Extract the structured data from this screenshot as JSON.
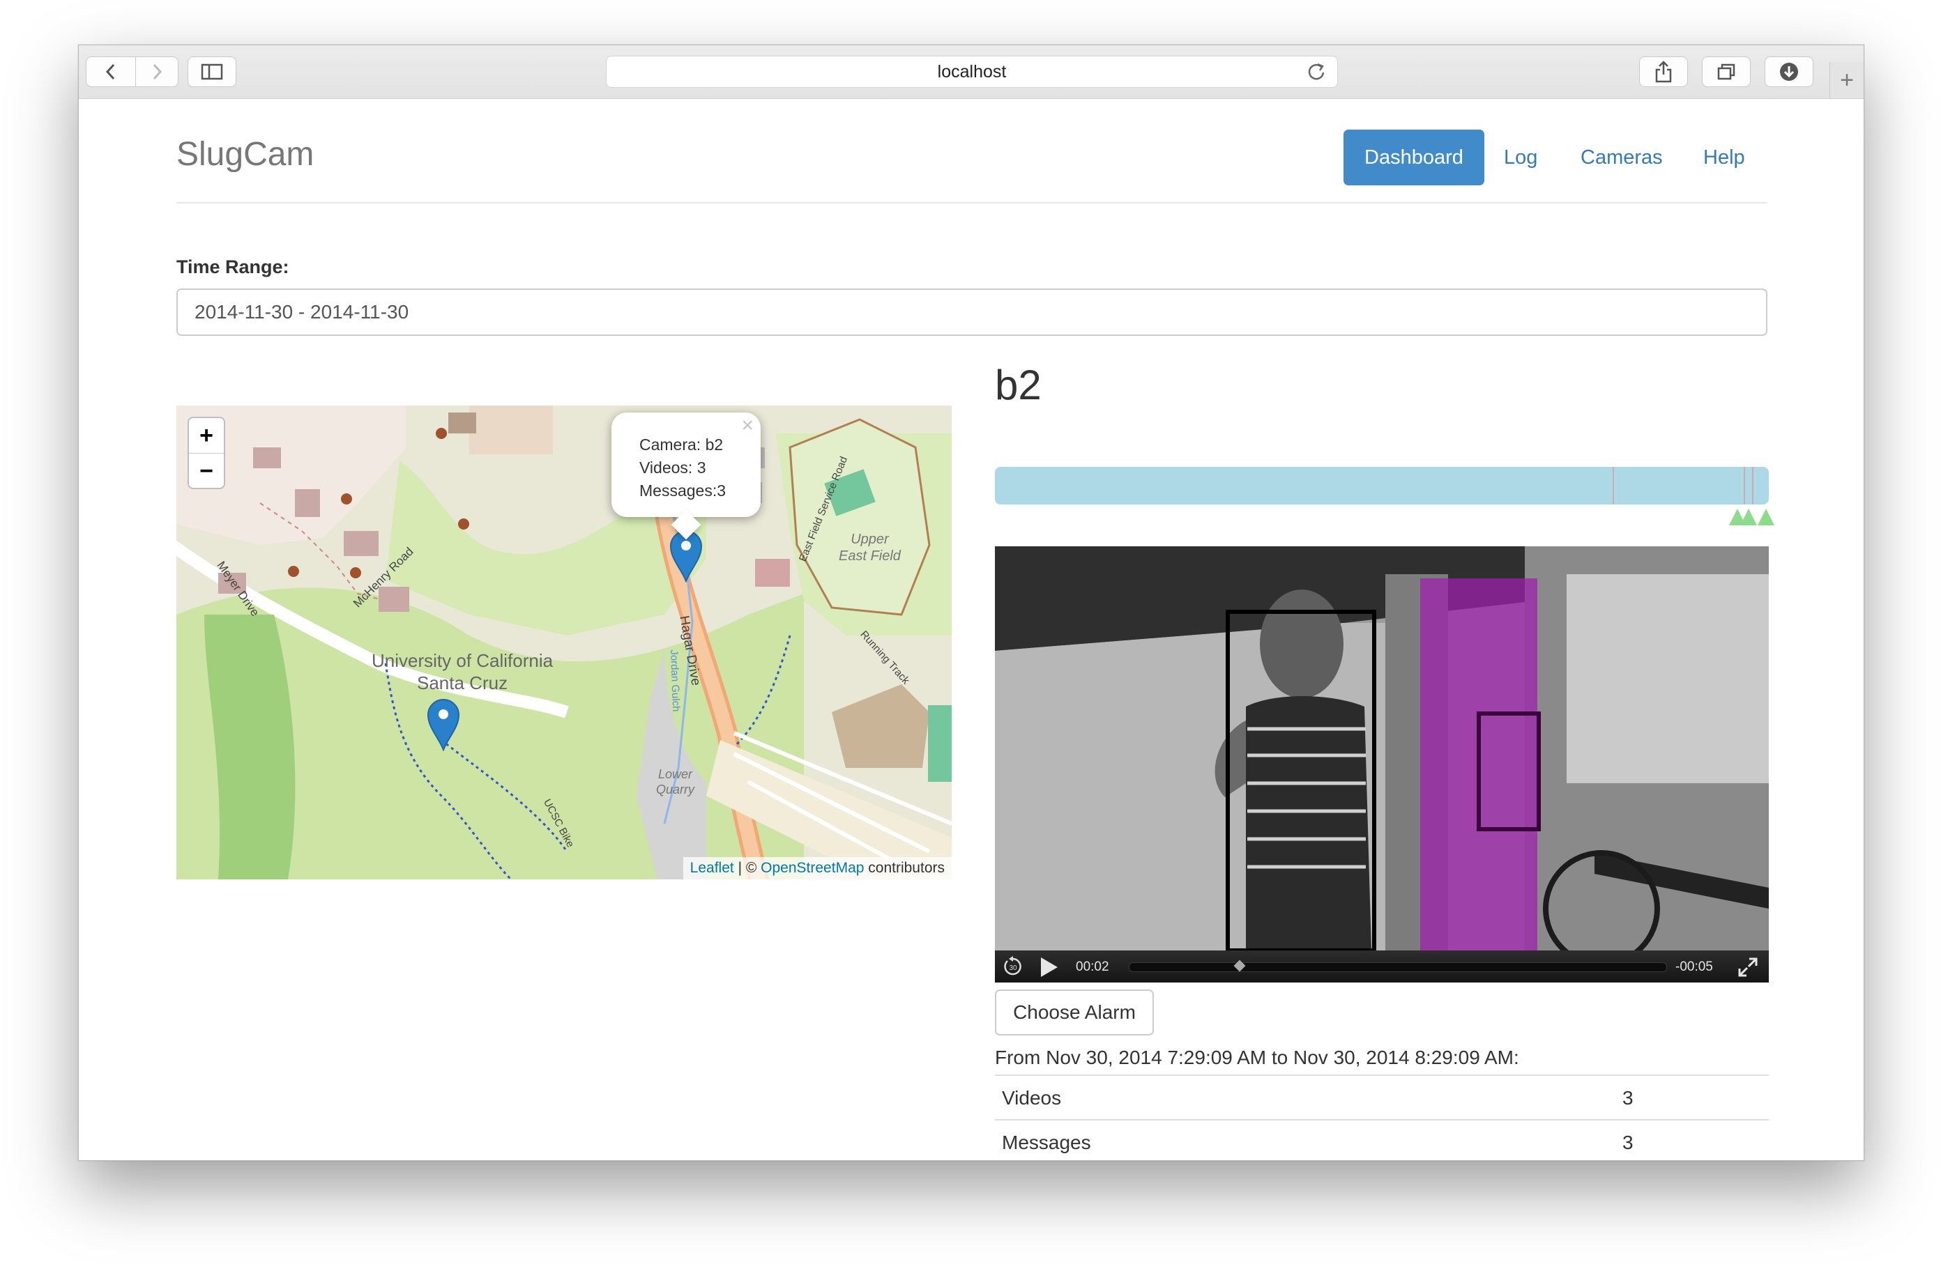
{
  "browser": {
    "url": "localhost",
    "back_icon": "chevron-left-icon",
    "forward_icon": "chevron-right-icon",
    "sidebar_icon": "sidebar-icon",
    "reload_icon": "reload-icon",
    "share_icon": "share-icon",
    "tabs_icon": "tabs-icon",
    "download_icon": "download-icon",
    "new_tab_icon": "plus-icon"
  },
  "header": {
    "brand": "SlugCam",
    "nav": [
      "Dashboard",
      "Log",
      "Cameras",
      "Help"
    ],
    "active_nav": "Dashboard",
    "accent_color": "#428bca"
  },
  "filter": {
    "label": "Time Range:",
    "value": "2014-11-30 - 2014-11-30"
  },
  "map": {
    "zoom_in": "+",
    "zoom_out": "−",
    "popup": {
      "camera": "Camera: b2",
      "videos": "Videos: 3",
      "messages": "Messages:3",
      "close": "×"
    },
    "labels": {
      "campus_line1": "University of California",
      "campus_line2": "Santa Cruz",
      "upper_field_line1": "Upper",
      "upper_field_line2": "East Field",
      "hagar": "Hagar Drive",
      "mchenry": "McHenry Road",
      "meyer": "Meyer Drive",
      "lower_quarry_line1": "Lower",
      "lower_quarry_line2": "Quarry",
      "east_field_service": "East Field Service Road",
      "running_track": "Running Track",
      "jordan_gulch": "Jordan Gulch",
      "ucsc_bike": "UCSC Bike"
    },
    "markers": [
      "camera-b2-marker",
      "camera-marker-2"
    ],
    "attribution": {
      "leaflet": "Leaflet",
      "sep": " | © ",
      "osm": "OpenStreetMap",
      "suffix": " contributors"
    }
  },
  "camera": {
    "name": "b2",
    "timeline_color": "#add8e6",
    "video": {
      "current_time": "00:02",
      "remaining_time": "-00:05",
      "progress": 0.2,
      "skip_back_label": "30"
    },
    "choose_alarm_label": "Choose Alarm",
    "range_text": "From Nov 30, 2014 7:29:09 AM to Nov 30, 2014 8:29:09 AM:",
    "stats": [
      {
        "label": "Videos",
        "value": "3"
      },
      {
        "label": "Messages",
        "value": "3"
      }
    ]
  }
}
